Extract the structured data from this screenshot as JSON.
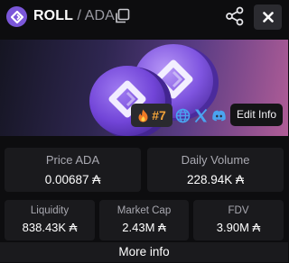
{
  "header": {
    "token_symbol": "ROLL",
    "separator": " / ",
    "quote_symbol": "ADA",
    "icons": {
      "logo": "roll-token-logo-icon",
      "copy": "copy-icon",
      "share": "share-icon",
      "close": "close-icon"
    }
  },
  "banner": {
    "rank": "#7",
    "rank_icon": "flame-icon",
    "socials": [
      "globe-icon",
      "x-twitter-icon",
      "discord-icon"
    ],
    "edit_label": "Edit Info"
  },
  "stats": {
    "price": {
      "label": "Price ADA",
      "value": "0.00687 ₳"
    },
    "volume": {
      "label": "Daily Volume",
      "value": "228.94K ₳"
    },
    "liquidity": {
      "label": "Liquidity",
      "value": "838.43K ₳"
    },
    "market_cap": {
      "label": "Market Cap",
      "value": "2.43M ₳"
    },
    "fdv": {
      "label": "FDV",
      "value": "3.90M ₳"
    }
  },
  "footer": {
    "more_label": "More info"
  },
  "colors": {
    "background": "#0d0d0f",
    "card": "#1a1a1d",
    "accent_purple": "#7b57d9",
    "rank_orange": "#f2a33a",
    "social_blue": "#4aa3f0"
  }
}
